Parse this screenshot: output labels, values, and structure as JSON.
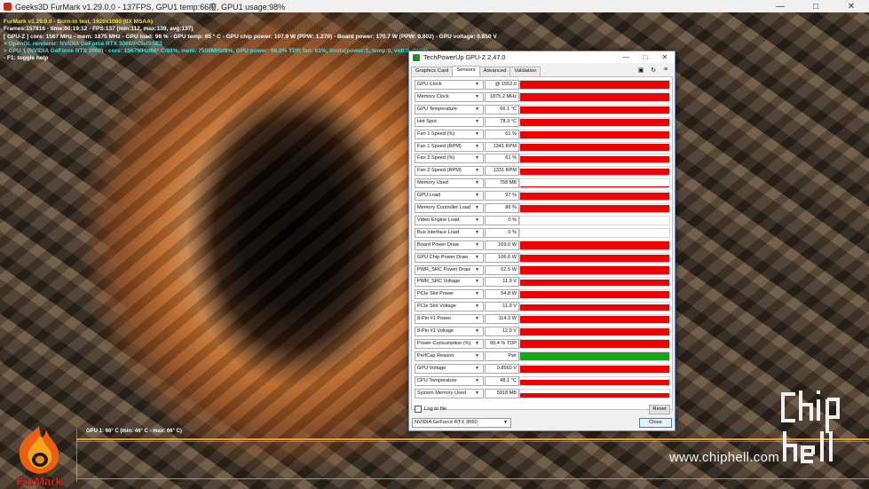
{
  "window": {
    "title": "Geeks3D FurMark v1.29.0.0 - 137FPS, GPU1 temp:66癈, GPU1 usage:98%",
    "controls": [
      "—",
      "□",
      "✕"
    ]
  },
  "overlay": {
    "line1": "FurMark v1.29.0.0 - Burn-in test, 1920x1080 (0X MSAA)",
    "line2": "Frames:157816 - time:00:19:12 - FPS:137 (min:112, max:139, avg:137)",
    "line3": "[ GPU-Z ] core: 1567 MHz - mem: 1875 MHz - GPU load: 98 % - GPU temp: 65 ° C - GPU chip power: 107.9 W (PPW: 1.270) - Board power: 170.7 W (PPW: 0.802) - GPU voltage: 0.850 V",
    "line4": "> OpenGL renderer: NVIDIA GeForce RTX 3060/PCIe/SSE2",
    "line5": "> GPU 1 (NVIDIA GeForce RTX 3060) - core: 1567MHz/66° C/98%, mem: 7500MHz/8%, GPU power: 98.0% TDP, fan: 61%, limits[power:1, temp:0, volt:0, OV:0]",
    "line6": "- F1: toggle help"
  },
  "graph": {
    "label": "GPU 1: 66° C (min: 46° C - max: 66° C)"
  },
  "logo": {
    "text": "FurMark"
  },
  "watermark": {
    "url": "www.chiphell.com",
    "brand": "chip hell"
  },
  "gpuz": {
    "title": "TechPowerUp GPU-Z 2.47.0",
    "tabs": [
      "Graphics Card",
      "Sensors",
      "Advanced",
      "Validation"
    ],
    "active_tab": "Sensors",
    "toolbar_icons": [
      "camera-icon",
      "refresh-icon",
      "menu-icon"
    ],
    "sensors": [
      {
        "label": "GPU Clock",
        "value": "@ 1552.0",
        "level": 0.95,
        "color": "#ee0000"
      },
      {
        "label": "Memory Clock",
        "value": "1875.2 MHz",
        "level": 0.95,
        "color": "#ee0000"
      },
      {
        "label": "GPU Temperature",
        "value": "66.1 °C",
        "level": 0.9,
        "color": "#ee0000"
      },
      {
        "label": "Hot Spot",
        "value": "78.3 °C",
        "level": 0.9,
        "color": "#ee0000"
      },
      {
        "label": "Fan 1 Speed (%)",
        "value": "61 %",
        "level": 0.85,
        "color": "#ee0000"
      },
      {
        "label": "Fan 1 Speed (RPM)",
        "value": "1341 RPM",
        "level": 0.85,
        "color": "#ee0000"
      },
      {
        "label": "Fan 2 Speed (%)",
        "value": "61 %",
        "level": 0.85,
        "color": "#ee0000"
      },
      {
        "label": "Fan 2 Speed (RPM)",
        "value": "1331 RPM",
        "level": 0.85,
        "color": "#ee0000"
      },
      {
        "label": "Memory Used",
        "value": "758 MB",
        "level": 0.1,
        "color": "#ee0000"
      },
      {
        "label": "GPU Load",
        "value": "97 %",
        "level": 0.95,
        "color": "#ee0000"
      },
      {
        "label": "Memory Controller Load",
        "value": "86 %",
        "level": 0.85,
        "color": "#ee0000"
      },
      {
        "label": "Video Engine Load",
        "value": "0 %",
        "level": 0,
        "color": "#ee0000"
      },
      {
        "label": "Bus Interface Load",
        "value": "0 %",
        "level": 0,
        "color": "#ee0000"
      },
      {
        "label": "Board Power Draw",
        "value": "169.0 W",
        "level": 0.95,
        "color": "#ee0000"
      },
      {
        "label": "GPU Chip Power Draw",
        "value": "106.6 W",
        "level": 0.9,
        "color": "#ee0000"
      },
      {
        "label": "PWR_SRC Power Draw",
        "value": "62.5 W",
        "level": 0.9,
        "color": "#ee0000"
      },
      {
        "label": "PWR_SRC Voltage",
        "value": "11.9 V",
        "level": 0.85,
        "color": "#ee0000"
      },
      {
        "label": "PCIe Slot Power",
        "value": "54.8 W",
        "level": 0.9,
        "color": "#ee0000"
      },
      {
        "label": "PCIe Slot Voltage",
        "value": "11.9 V",
        "level": 0.85,
        "color": "#ee0000"
      },
      {
        "label": "8-Pin #1 Power",
        "value": "114.3 W",
        "level": 0.9,
        "color": "#ee0000"
      },
      {
        "label": "8-Pin #1 Voltage",
        "value": "12.0 V",
        "level": 0.85,
        "color": "#ee0000"
      },
      {
        "label": "Power Consumption (%)",
        "value": "99.4 % TDP",
        "level": 0.95,
        "color": "#ee0000"
      },
      {
        "label": "PerfCap Reason",
        "value": "Pwr",
        "level": 1.0,
        "color": "#14a614"
      },
      {
        "label": "GPU Voltage",
        "value": "0.8560 V",
        "level": 0.85,
        "color": "#ee0000"
      },
      {
        "label": "CPU Temperature",
        "value": "48.1 °C",
        "level": 0.6,
        "color": "#ee0000"
      },
      {
        "label": "System Memory Used",
        "value": "5918 MB",
        "level": 0.5,
        "color": "#ee0000"
      }
    ],
    "log_to_file_label": "Log to file",
    "log_to_file_checked": false,
    "reset_label": "Reset",
    "gpu_select_value": "NVIDIA GeForce RTX 3060",
    "close_label": "Close"
  }
}
